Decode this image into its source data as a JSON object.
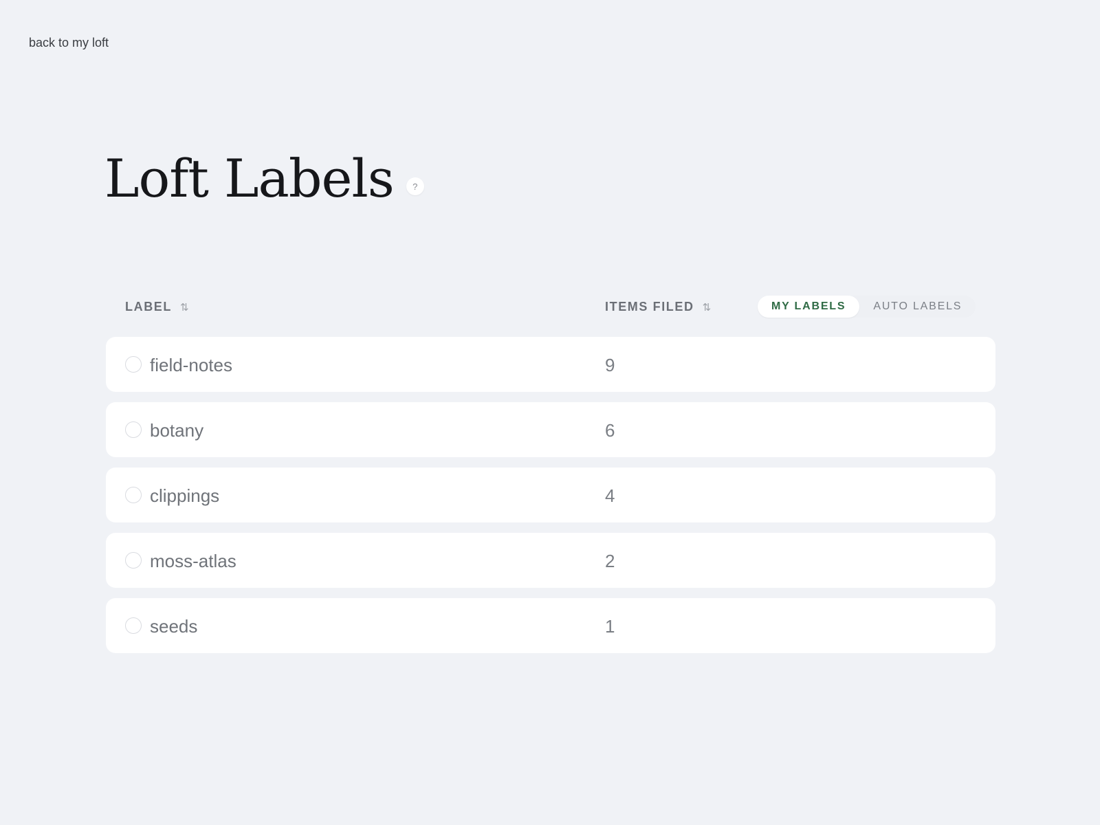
{
  "nav": {
    "back_label": "back to my loft"
  },
  "page": {
    "title": "Loft Labels",
    "help_label": "?"
  },
  "table": {
    "columns": {
      "label": "LABEL",
      "count": "ITEMS FILED"
    },
    "sort_icon": "⇅",
    "tabs": [
      {
        "label": "MY LABELS",
        "active": true
      },
      {
        "label": "AUTO LABELS",
        "active": false
      }
    ],
    "rows": [
      {
        "name": "field-notes",
        "count": "9"
      },
      {
        "name": "botany",
        "count": "6"
      },
      {
        "name": "clippings",
        "count": "4"
      },
      {
        "name": "moss-atlas",
        "count": "2"
      },
      {
        "name": "seeds",
        "count": "1"
      }
    ]
  },
  "colors": {
    "background": "#f0f2f6",
    "active_tab_text": "#2f6b45",
    "row_background": "#ffffff"
  },
  "icons": {
    "help": "help-icon",
    "sort": "sort-icon",
    "row_select": "radio-circle-icon"
  }
}
